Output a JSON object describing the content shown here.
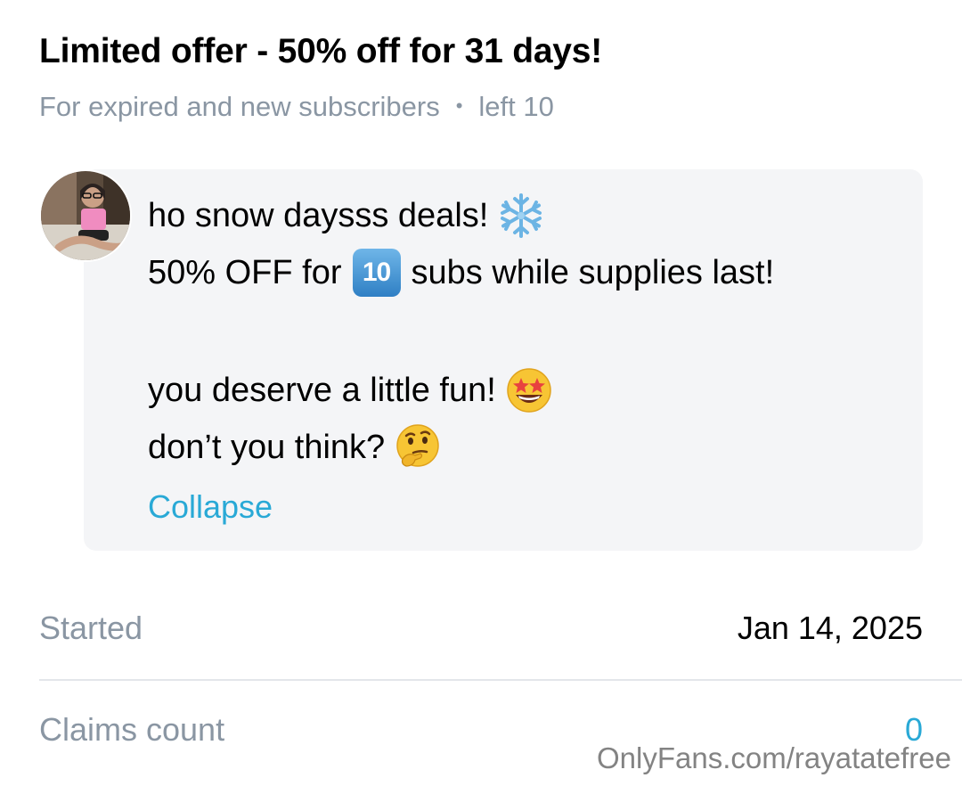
{
  "offer": {
    "title": "Limited offer - 50% off for 31 days!",
    "audience": "For expired and new subscribers",
    "separator": "•",
    "remaining": "left 10"
  },
  "message": {
    "line1": "ho snow daysss deals!",
    "line1_emoji": "snowflake-icon",
    "line2_prefix": "50% OFF for",
    "line2_keycap": "10",
    "line2_suffix": "subs while supplies last!",
    "line3": "you deserve a little fun!",
    "line3_emoji": "star-struck-icon",
    "line4": "don’t you think?",
    "line4_emoji": "thinking-face-icon",
    "collapse_label": "Collapse"
  },
  "details": {
    "started_label": "Started",
    "started_value": "Jan 14, 2025",
    "claims_label": "Claims count",
    "claims_value": "0"
  },
  "watermark": "OnlyFans.com/rayatatefree",
  "colors": {
    "accent": "#29a9d6",
    "muted_text": "#8a96a3",
    "bubble_bg": "#f4f5f7"
  }
}
